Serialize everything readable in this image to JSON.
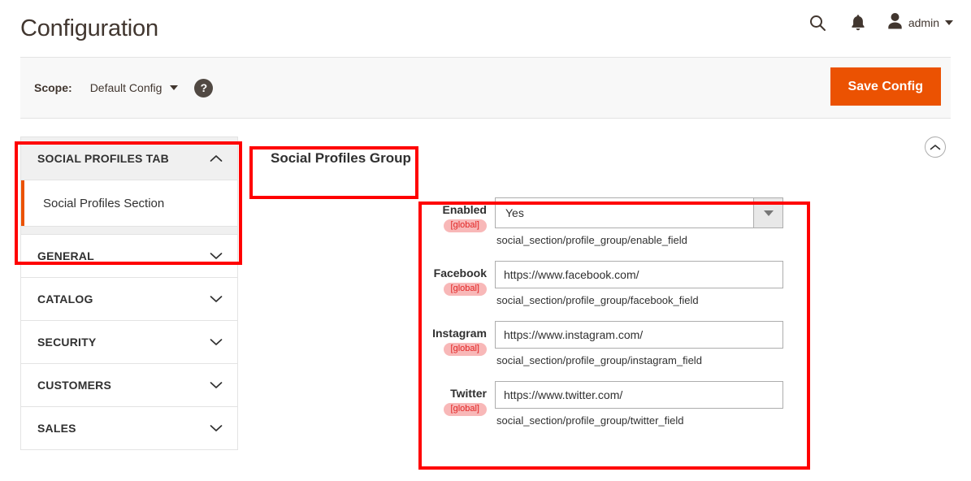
{
  "header": {
    "title": "Configuration",
    "search_icon": "search-icon",
    "notification_icon": "bell-icon",
    "avatar_icon": "user-avatar-icon",
    "admin_name": "admin"
  },
  "scope_bar": {
    "label": "Scope:",
    "selected": "Default Config",
    "help_icon": "question-mark-icon",
    "save_label": "Save Config",
    "accent_color": "#eb5202"
  },
  "sidebar": {
    "active_tab": {
      "label": "SOCIAL PROFILES TAB",
      "chevron": "chevron-up-icon",
      "items": [
        {
          "label": "Social Profiles Section",
          "current": true
        }
      ]
    },
    "tabs": [
      {
        "label": "GENERAL",
        "chevron": "chevron-down-icon"
      },
      {
        "label": "CATALOG",
        "chevron": "chevron-down-icon"
      },
      {
        "label": "SECURITY",
        "chevron": "chevron-down-icon"
      },
      {
        "label": "CUSTOMERS",
        "chevron": "chevron-down-icon"
      },
      {
        "label": "SALES",
        "chevron": "chevron-down-icon"
      }
    ]
  },
  "main": {
    "group_title": "Social Profiles Group",
    "collapse_icon": "chevron-up-circle-icon",
    "scope_badge": "[global]",
    "fields": [
      {
        "label": "Enabled",
        "scope": "[global]",
        "type": "select",
        "value": "Yes",
        "hint": "social_section/profile_group/enable_field"
      },
      {
        "label": "Facebook",
        "scope": "[global]",
        "type": "text",
        "value": "https://www.facebook.com/",
        "hint": "social_section/profile_group/facebook_field"
      },
      {
        "label": "Instagram",
        "scope": "[global]",
        "type": "text",
        "value": "https://www.instagram.com/",
        "hint": "social_section/profile_group/instagram_field"
      },
      {
        "label": "Twitter",
        "scope": "[global]",
        "type": "text",
        "value": "https://www.twitter.com/",
        "hint": "social_section/profile_group/twitter_field"
      }
    ]
  },
  "annotations": {
    "color": "#ff0000",
    "boxes": [
      "sidebar-tab-highlight",
      "group-title-highlight",
      "fields-highlight"
    ]
  }
}
